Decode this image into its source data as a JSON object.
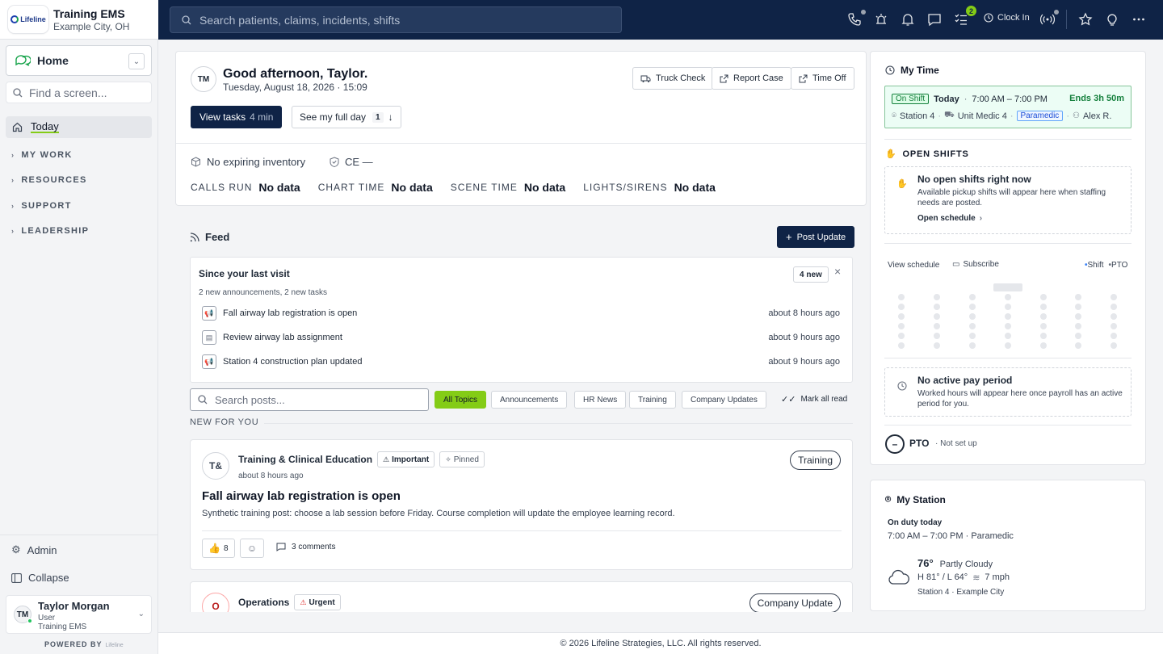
{
  "org": {
    "logo_text": "Lifeline",
    "name": "Training EMS",
    "city": "Example City, OH"
  },
  "sidebar": {
    "home_label": "Home",
    "find_placeholder": "Find a screen...",
    "today_label": "Today",
    "sections": [
      "MY WORK",
      "RESOURCES",
      "SUPPORT",
      "LEADERSHIP"
    ],
    "admin_label": "Admin",
    "collapse_label": "Collapse"
  },
  "user": {
    "initials": "TM",
    "name": "Taylor Morgan",
    "role": "User",
    "org": "Training EMS"
  },
  "powered_by": "POWERED BY",
  "powered_logo": "Lifeline",
  "topbar": {
    "search_placeholder": "Search patients, claims, incidents, shifts",
    "task_badge": "2",
    "clock_in": "Clock In"
  },
  "greeting": {
    "initials": "TM",
    "title": "Good afternoon, Taylor.",
    "date": "Tuesday, August 18, 2026 · 15:09",
    "actions": [
      "Truck Check",
      "Report Case",
      "Time Off"
    ],
    "view_tasks": "View tasks",
    "view_tasks_time": "4 min",
    "see_day": "See my full day",
    "see_day_count": "1",
    "inventory": "No expiring inventory",
    "ce": "CE —",
    "metrics": [
      {
        "label": "CALLS RUN",
        "value": "No data"
      },
      {
        "label": "CHART TIME",
        "value": "No data"
      },
      {
        "label": "SCENE TIME",
        "value": "No data"
      },
      {
        "label": "LIGHTS/SIRENS",
        "value": "No data"
      }
    ]
  },
  "feed": {
    "title": "Feed",
    "post_update": "Post Update",
    "since_title": "Since your last visit",
    "since_count": "4 new",
    "since_summary": "2 new announcements, 2 new tasks",
    "since_items": [
      {
        "icon": "megaphone-icon",
        "text": "Fall airway lab registration is open",
        "time": "about 8 hours ago"
      },
      {
        "icon": "clipboard-icon",
        "text": "Review airway lab assignment",
        "time": "about 9 hours ago"
      },
      {
        "icon": "megaphone-icon",
        "text": "Station 4 construction plan updated",
        "time": "about 9 hours ago"
      }
    ],
    "search_placeholder": "Search posts...",
    "topics": [
      "All Topics",
      "Announcements",
      "HR News",
      "Training",
      "Company Updates"
    ],
    "mark_all_read": "Mark all read",
    "new_for_you": "NEW FOR YOU",
    "posts": [
      {
        "initials": "T&",
        "author": "Training & Clinical Education",
        "important": "Important",
        "pinned": "Pinned",
        "time": "about 8 hours ago",
        "category": "Training",
        "title": "Fall airway lab registration is open",
        "body": "Synthetic training post: choose a lab session before Friday. Course completion will update the employee learning record.",
        "likes": "8",
        "comments": "3 comments"
      },
      {
        "initials": "O",
        "author": "Operations",
        "urgent": "Urgent",
        "category": "Company Update"
      }
    ]
  },
  "my_time": {
    "title": "My Time",
    "status": "On Shift",
    "day": "Today",
    "hours": "7:00 AM – 7:00 PM",
    "ends": "Ends 3h 50m",
    "station": "Station 4",
    "unit": "Unit Medic 4",
    "role": "Paramedic",
    "partner": "Alex R.",
    "open_shifts_title": "OPEN SHIFTS",
    "no_shifts_title": "No open shifts right now",
    "no_shifts_body": "Available pickup shifts will appear here when staffing needs are posted.",
    "open_schedule": "Open schedule",
    "view_schedule": "View schedule",
    "subscribe": "Subscribe",
    "legend": [
      "Shift",
      "PTO"
    ],
    "no_pay_title": "No active pay period",
    "no_pay_body": "Worked hours will appear here once payroll has an active period for you.",
    "pto": "PTO",
    "pto_status": "· Not set up"
  },
  "my_station": {
    "title": "My Station",
    "on_duty": "On duty today",
    "duty_hours": "7:00 AM – 7:00 PM · Paramedic",
    "temp": "76°",
    "condition": "Partly Cloudy",
    "hi_lo": "H 81° / L 64°",
    "wind": "7 mph",
    "location": "Station 4 · Example City"
  },
  "footer": "© 2026 Lifeline Strategies, LLC. All rights reserved.",
  "colors": {
    "navy": "#0f2346",
    "accent": "#84cc16",
    "shift_green": "#15803d"
  }
}
